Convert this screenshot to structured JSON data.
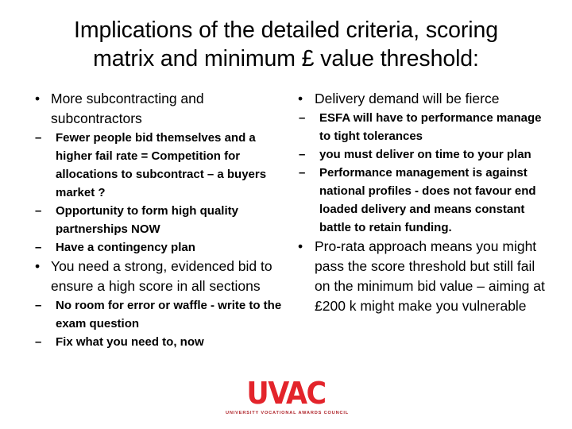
{
  "slide": {
    "title_lines": [
      "Implications of the detailed criteria, scoring",
      "matrix and minimum £ value threshold:"
    ],
    "background_color": "#FFFFFF",
    "text_color": "#000000"
  },
  "left_column": {
    "bullets": [
      {
        "marker": "•",
        "text": "More subcontracting and subcontractors",
        "sub_bullets": [
          {
            "marker": "–",
            "text": "Fewer people bid themselves and a higher fail rate  = Competition for allocations to subcontract – a buyers market ?"
          },
          {
            "marker": "–",
            "text": "Opportunity to form high quality partnerships NOW"
          },
          {
            "marker": "–",
            "text": "Have a contingency plan"
          }
        ]
      },
      {
        "marker": "•",
        "text": "You need a strong, evidenced bid to ensure a high score in all sections",
        "sub_bullets": [
          {
            "marker": "–",
            "text": "No room for error or waffle  - write to the exam question"
          },
          {
            "marker": "–",
            "text": "Fix what you need to, now"
          }
        ]
      }
    ]
  },
  "right_column": {
    "bullets": [
      {
        "marker": "•",
        "text": "Delivery demand will be fierce",
        "sub_bullets": [
          {
            "marker": "–",
            "text": "ESFA will have to performance manage to tight tolerances"
          },
          {
            "marker": "–",
            "text": "you must deliver on time to your plan"
          },
          {
            "marker": "–",
            "text": "Performance management is against national profiles  - does not favour end loaded delivery and means constant battle to retain funding."
          }
        ]
      },
      {
        "marker": "•",
        "text": "Pro-rata approach means you might pass the score threshold but still fail on the minimum bid value – aiming at £200 k might make you vulnerable",
        "sub_bullets": []
      }
    ]
  },
  "logo": {
    "wordmark": "UVAC",
    "tagline": "UNIVERSITY VOCATIONAL AWARDS COUNCIL",
    "color": "#E3242B",
    "tagline_color": "#B0272D"
  }
}
